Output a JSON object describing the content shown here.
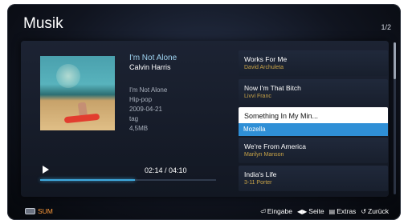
{
  "header": {
    "title": "Musik",
    "page": "1/2"
  },
  "now_playing": {
    "title": "I'm Not Alone",
    "artist": "Calvin Harris",
    "album": "I'm Not Alone",
    "genre": "Hip-pop",
    "date": "2009-04-21",
    "tag": "tag",
    "size": "4,5MB",
    "time": "02:14 / 04:10",
    "progress_fraction": 0.54,
    "play_icon": "play-icon"
  },
  "playlist": {
    "items": [
      {
        "title": "Works For Me",
        "artist": "David Archuleta"
      },
      {
        "title": "Now I'm That Bitch",
        "artist": "Livvi Franc"
      },
      {
        "title": "Something In My Min...",
        "artist": "Mozella"
      },
      {
        "title": "We're From America",
        "artist": "Marilyn Manson"
      },
      {
        "title": "India's Life",
        "artist": "3-11 Porter"
      }
    ],
    "selected_index": 2
  },
  "footer": {
    "sum_label": "SUM",
    "hints": {
      "enter": "Eingabe",
      "page": "Seite",
      "tools": "Extras",
      "back": "Zurück"
    }
  },
  "colors": {
    "accent": "#2f8fd6",
    "artist": "#c8a347",
    "sum": "#ff9a3a"
  }
}
